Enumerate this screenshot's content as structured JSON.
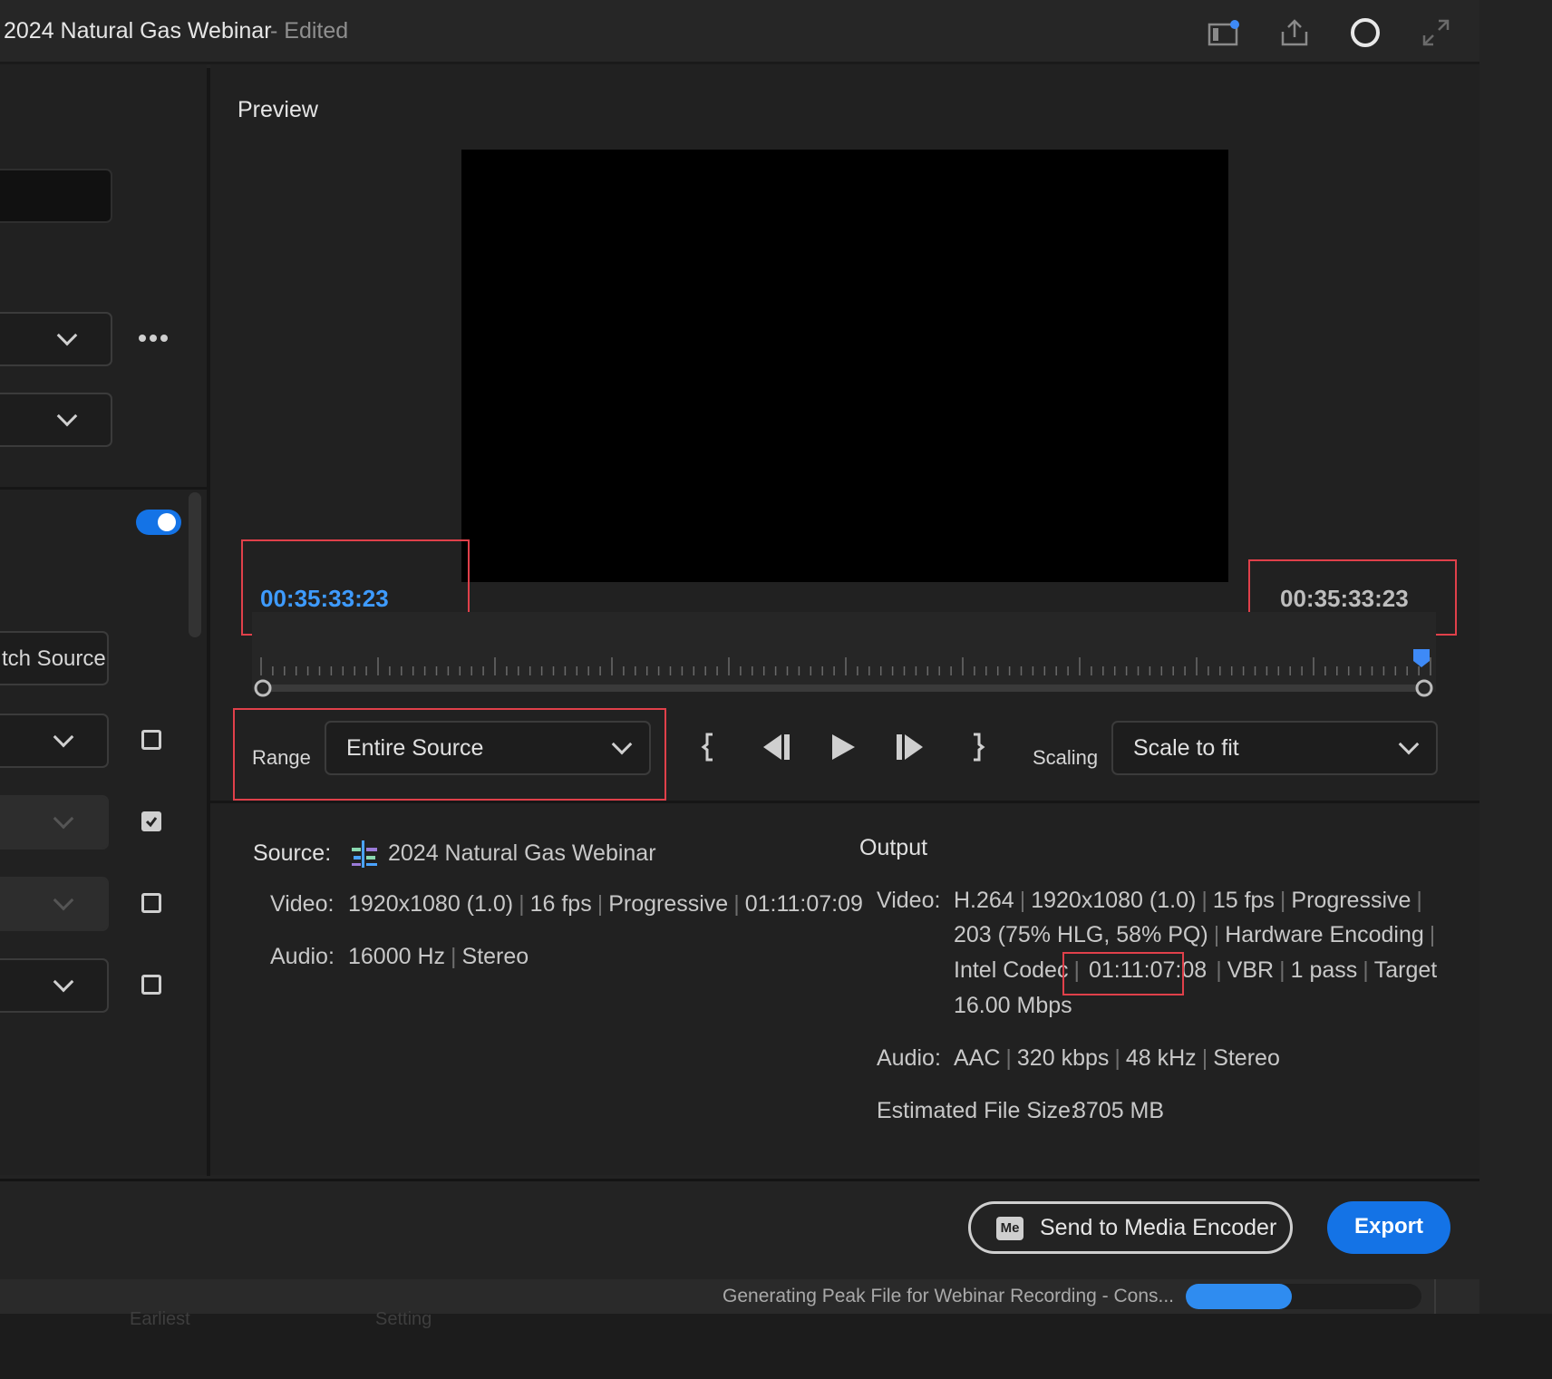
{
  "header": {
    "title": "2024 Natural Gas Webinar",
    "edited": "- Edited",
    "icons": [
      "workspace-icon",
      "share-icon",
      "progress-ring-icon",
      "fullscreen-icon"
    ]
  },
  "left_panel": {
    "match_source_label": "tch Source",
    "more_icon": "more-icon"
  },
  "preview": {
    "title": "Preview",
    "timecode_in": "00:35:33:23",
    "timecode_out": "00:35:33:23",
    "playhead_position": 1.0
  },
  "controls": {
    "range_label": "Range",
    "range_value": "Entire Source",
    "scaling_label": "Scaling",
    "scaling_value": "Scale to fit"
  },
  "source": {
    "label": "Source:",
    "name": "2024 Natural Gas Webinar",
    "video_label": "Video:",
    "video_parts": [
      "1920x1080 (1.0)",
      "16 fps",
      "Progressive",
      "01:11:07:09"
    ],
    "audio_label": "Audio:",
    "audio_parts": [
      "16000 Hz",
      "Stereo"
    ]
  },
  "output": {
    "title": "Output",
    "video_label": "Video:",
    "video_line1": [
      "H.264",
      "1920x1080 (1.0)",
      "15 fps",
      "Progressive"
    ],
    "video_line2": [
      "203 (75% HLG, 58% PQ)",
      "Hardware Encoding"
    ],
    "video_line3_start": "Intel Codec",
    "video_duration": "01:11:07:08",
    "video_line3_end": [
      "VBR",
      "1 pass",
      "Target"
    ],
    "video_line4": "16.00 Mbps",
    "audio_label": "Audio:",
    "audio_parts": [
      "AAC",
      "320 kbps",
      "48 kHz",
      "Stereo"
    ],
    "filesize_label": "Estimated File Size:",
    "filesize_value": "8705 MB"
  },
  "footer": {
    "me_badge": "Me",
    "send_label": "Send to Media Encoder",
    "export_label": "Export"
  },
  "status": {
    "text": "Generating Peak File for Webinar Recording - Cons...",
    "progress": 0.45
  },
  "below": {
    "text1": "Earliest",
    "text2": "Setting"
  },
  "colors": {
    "accent": "#1473e6",
    "timecode_in": "#3e9bff",
    "highlight": "#e0404a"
  }
}
